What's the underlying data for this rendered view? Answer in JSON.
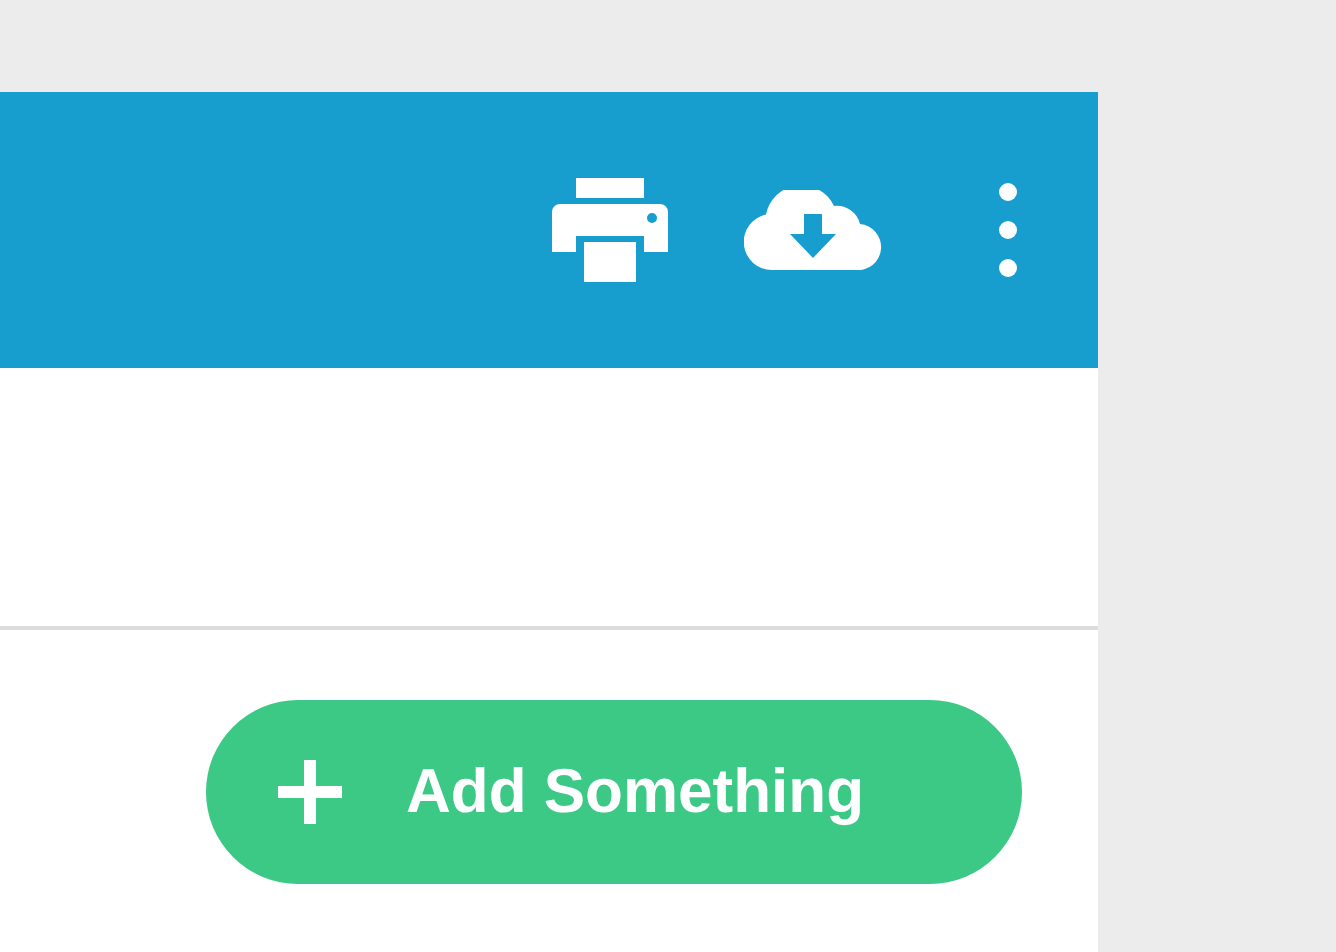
{
  "add_button": {
    "label": "Add Something"
  }
}
